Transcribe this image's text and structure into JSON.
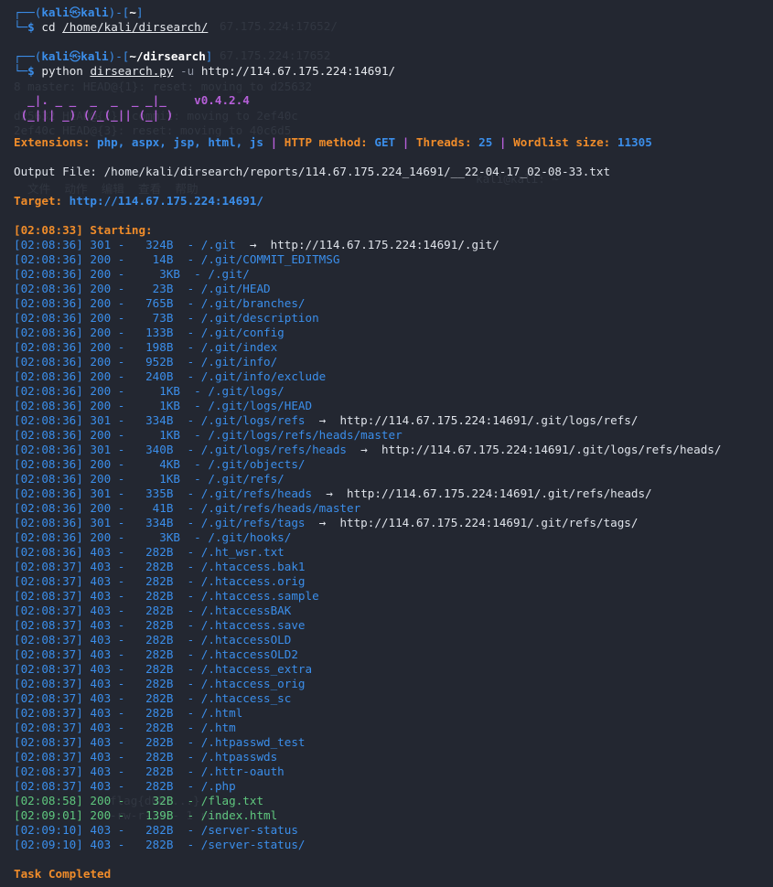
{
  "prompt": {
    "user": "kali",
    "at": "㉿",
    "host": "kali",
    "dollar": "$"
  },
  "commands": [
    {
      "path": "~",
      "name": "cd",
      "arg": "/home/kali/dirsearch/",
      "flag": "",
      "rest": ""
    },
    {
      "path": "~/dirsearch",
      "name": "python",
      "arg": "dirsearch.py",
      "flag": "-u",
      "rest": "http://114.67.175.224:14691/"
    }
  ],
  "banner": {
    "logo_line1": "  _|. _ _  _  _  _ _|_    ",
    "logo_line2": " (_||| _) (/_(_|| (_| )",
    "version": "v0.4.2.4"
  },
  "config": {
    "extensions_label": "Extensions:",
    "extensions_value": "php, aspx, jsp, html, js",
    "method_label": "HTTP method:",
    "method_value": "GET",
    "threads_label": "Threads:",
    "threads_value": "25",
    "wordlist_label": "Wordlist size:",
    "wordlist_value": "11305"
  },
  "output_file": "Output File: /home/kali/dirsearch/reports/114.67.175.224_14691/__22-04-17_02-08-33.txt",
  "target": {
    "label": "Target:",
    "url": "http://114.67.175.224:14691/"
  },
  "starting": "[02:08:33] Starting:",
  "results": [
    {
      "time": "[02:08:36]",
      "code": "301",
      "size": " 324B",
      "path": "/.git",
      "redirect": "http://114.67.175.224:14691/.git/"
    },
    {
      "time": "[02:08:36]",
      "code": "200",
      "size": "  14B",
      "path": "/.git/COMMIT_EDITMSG",
      "redirect": ""
    },
    {
      "time": "[02:08:36]",
      "code": "200",
      "size": "   3KB",
      "path": "/.git/",
      "redirect": ""
    },
    {
      "time": "[02:08:36]",
      "code": "200",
      "size": "  23B",
      "path": "/.git/HEAD",
      "redirect": ""
    },
    {
      "time": "[02:08:36]",
      "code": "200",
      "size": " 765B",
      "path": "/.git/branches/",
      "redirect": ""
    },
    {
      "time": "[02:08:36]",
      "code": "200",
      "size": "  73B",
      "path": "/.git/description",
      "redirect": ""
    },
    {
      "time": "[02:08:36]",
      "code": "200",
      "size": " 133B",
      "path": "/.git/config",
      "redirect": ""
    },
    {
      "time": "[02:08:36]",
      "code": "200",
      "size": " 198B",
      "path": "/.git/index",
      "redirect": ""
    },
    {
      "time": "[02:08:36]",
      "code": "200",
      "size": " 952B",
      "path": "/.git/info/",
      "redirect": ""
    },
    {
      "time": "[02:08:36]",
      "code": "200",
      "size": " 240B",
      "path": "/.git/info/exclude",
      "redirect": ""
    },
    {
      "time": "[02:08:36]",
      "code": "200",
      "size": "   1KB",
      "path": "/.git/logs/",
      "redirect": ""
    },
    {
      "time": "[02:08:36]",
      "code": "200",
      "size": "   1KB",
      "path": "/.git/logs/HEAD",
      "redirect": ""
    },
    {
      "time": "[02:08:36]",
      "code": "301",
      "size": " 334B",
      "path": "/.git/logs/refs",
      "redirect": "http://114.67.175.224:14691/.git/logs/refs/"
    },
    {
      "time": "[02:08:36]",
      "code": "200",
      "size": "   1KB",
      "path": "/.git/logs/refs/heads/master",
      "redirect": ""
    },
    {
      "time": "[02:08:36]",
      "code": "301",
      "size": " 340B",
      "path": "/.git/logs/refs/heads",
      "redirect": "http://114.67.175.224:14691/.git/logs/refs/heads/"
    },
    {
      "time": "[02:08:36]",
      "code": "200",
      "size": "   4KB",
      "path": "/.git/objects/",
      "redirect": ""
    },
    {
      "time": "[02:08:36]",
      "code": "200",
      "size": "   1KB",
      "path": "/.git/refs/",
      "redirect": ""
    },
    {
      "time": "[02:08:36]",
      "code": "301",
      "size": " 335B",
      "path": "/.git/refs/heads",
      "redirect": "http://114.67.175.224:14691/.git/refs/heads/"
    },
    {
      "time": "[02:08:36]",
      "code": "200",
      "size": "  41B",
      "path": "/.git/refs/heads/master",
      "redirect": ""
    },
    {
      "time": "[02:08:36]",
      "code": "301",
      "size": " 334B",
      "path": "/.git/refs/tags",
      "redirect": "http://114.67.175.224:14691/.git/refs/tags/"
    },
    {
      "time": "[02:08:36]",
      "code": "200",
      "size": "   3KB",
      "path": "/.git/hooks/",
      "redirect": ""
    },
    {
      "time": "[02:08:36]",
      "code": "403",
      "size": " 282B",
      "path": "/.ht_wsr.txt",
      "redirect": ""
    },
    {
      "time": "[02:08:37]",
      "code": "403",
      "size": " 282B",
      "path": "/.htaccess.bak1",
      "redirect": ""
    },
    {
      "time": "[02:08:37]",
      "code": "403",
      "size": " 282B",
      "path": "/.htaccess.orig",
      "redirect": ""
    },
    {
      "time": "[02:08:37]",
      "code": "403",
      "size": " 282B",
      "path": "/.htaccess.sample",
      "redirect": ""
    },
    {
      "time": "[02:08:37]",
      "code": "403",
      "size": " 282B",
      "path": "/.htaccessBAK",
      "redirect": ""
    },
    {
      "time": "[02:08:37]",
      "code": "403",
      "size": " 282B",
      "path": "/.htaccess.save",
      "redirect": ""
    },
    {
      "time": "[02:08:37]",
      "code": "403",
      "size": " 282B",
      "path": "/.htaccessOLD",
      "redirect": ""
    },
    {
      "time": "[02:08:37]",
      "code": "403",
      "size": " 282B",
      "path": "/.htaccessOLD2",
      "redirect": ""
    },
    {
      "time": "[02:08:37]",
      "code": "403",
      "size": " 282B",
      "path": "/.htaccess_extra",
      "redirect": ""
    },
    {
      "time": "[02:08:37]",
      "code": "403",
      "size": " 282B",
      "path": "/.htaccess_orig",
      "redirect": ""
    },
    {
      "time": "[02:08:37]",
      "code": "403",
      "size": " 282B",
      "path": "/.htaccess_sc",
      "redirect": ""
    },
    {
      "time": "[02:08:37]",
      "code": "403",
      "size": " 282B",
      "path": "/.html",
      "redirect": ""
    },
    {
      "time": "[02:08:37]",
      "code": "403",
      "size": " 282B",
      "path": "/.htm",
      "redirect": ""
    },
    {
      "time": "[02:08:37]",
      "code": "403",
      "size": " 282B",
      "path": "/.htpasswd_test",
      "redirect": ""
    },
    {
      "time": "[02:08:37]",
      "code": "403",
      "size": " 282B",
      "path": "/.htpasswds",
      "redirect": ""
    },
    {
      "time": "[02:08:37]",
      "code": "403",
      "size": " 282B",
      "path": "/.httr-oauth",
      "redirect": ""
    },
    {
      "time": "[02:08:37]",
      "code": "403",
      "size": " 282B",
      "path": "/.php",
      "redirect": ""
    },
    {
      "time": "[02:08:58]",
      "code": "200",
      "size": "  32B",
      "path": "/flag.txt",
      "redirect": ""
    },
    {
      "time": "[02:09:01]",
      "code": "200",
      "size": " 139B",
      "path": "/index.html",
      "redirect": ""
    },
    {
      "time": "[02:09:10]",
      "code": "403",
      "size": " 282B",
      "path": "/server-status",
      "redirect": ""
    },
    {
      "time": "[02:09:10]",
      "code": "403",
      "size": " 282B",
      "path": "/server-status/",
      "redirect": ""
    }
  ],
  "completed": "Task Completed",
  "colors": {
    "background": "#232731",
    "prompt_blue": "#3b8eea",
    "label_orange": "#f08c2a",
    "logo_purple": "#b65fd9",
    "status_green": "#5fc77e"
  }
}
